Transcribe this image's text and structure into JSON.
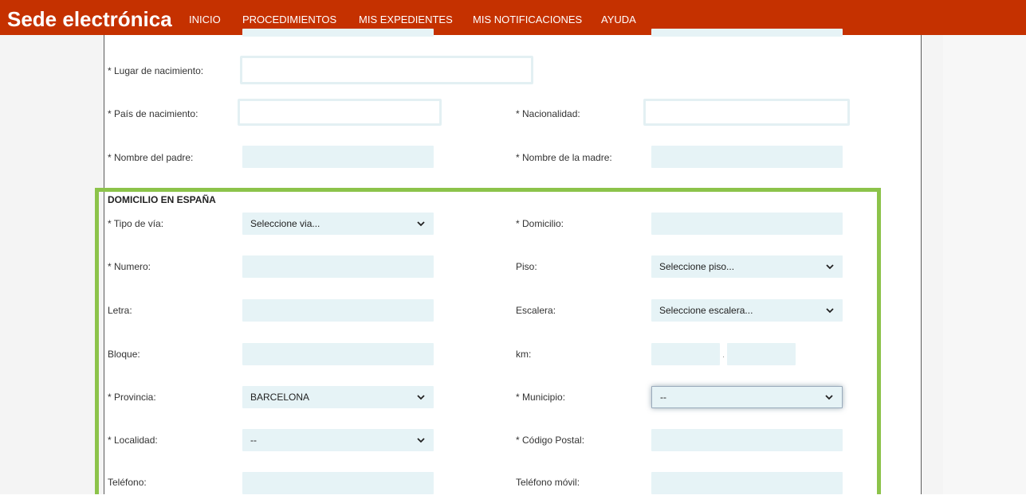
{
  "header": {
    "brand": "Sede electrónica",
    "nav": [
      "INICIO",
      "PROCEDIMIENTOS",
      "MIS EXPEDIENTES",
      "MIS NOTIFICACIONES",
      "AYUDA"
    ]
  },
  "personal": {
    "lugar_nacimiento": "* Lugar de nacimiento:",
    "pais_nacimiento": "* País de nacimiento:",
    "nacionalidad": "* Nacionalidad:",
    "nombre_padre": "* Nombre del padre:",
    "nombre_madre": "* Nombre de la madre:"
  },
  "domicilio": {
    "title": "DOMICILIO EN ESPAÑA",
    "tipo_via_label": "* Tipo de vía:",
    "tipo_via_value": "Seleccione via...",
    "domicilio_label": "* Domicilio:",
    "numero_label": "* Numero:",
    "piso_label": "Piso:",
    "piso_value": "Seleccione piso...",
    "letra_label": "Letra:",
    "escalera_label": "Escalera:",
    "escalera_value": "Seleccione escalera...",
    "bloque_label": "Bloque:",
    "km_label": "km:",
    "km_separator": ".",
    "provincia_label": "* Provincia:",
    "provincia_value": "BARCELONA",
    "municipio_label": "* Municipio:",
    "municipio_value": "--",
    "localidad_label": "* Localidad:",
    "localidad_value": "--",
    "codigo_postal_label": "* Código Postal:",
    "telefono_label": "Teléfono:",
    "telefono_movil_label": "Teléfono móvil:"
  },
  "colors": {
    "header_bg": "#c53100",
    "field_bg": "#e6f3f6",
    "section_border": "#8cc34a"
  }
}
